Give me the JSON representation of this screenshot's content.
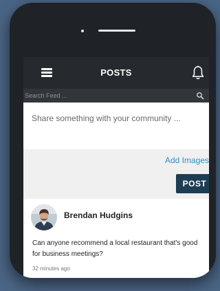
{
  "header": {
    "title": "POSTS",
    "menu_icon": "hamburger-menu-icon",
    "notification_icon": "bell-icon"
  },
  "search": {
    "placeholder": "Search Feed ...",
    "icon": "search-icon"
  },
  "compose": {
    "placeholder": "Share something with your community ...",
    "add_images_label": "Add Images",
    "post_button_label": "POST"
  },
  "feed": [
    {
      "author": "Brendan Hudgins",
      "text": "Can anyone recommend a local restaurant that's good for business meetings?",
      "time": "32 minutes ago"
    }
  ],
  "colors": {
    "background": "#4a6585",
    "header": "#262a2e",
    "search_bar": "#31363b",
    "link": "#2f8fc6",
    "post_button": "#1d3d52"
  }
}
